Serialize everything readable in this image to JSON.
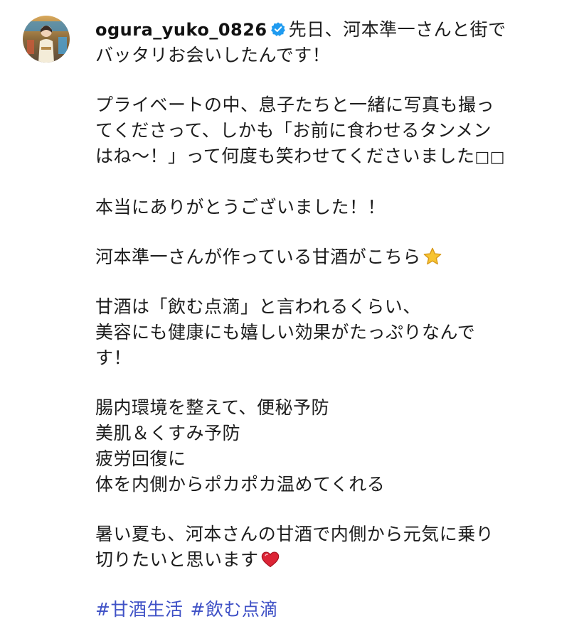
{
  "post": {
    "username": "ogura_yuko_0826",
    "verified_icon": "verified-badge-icon",
    "avatar_icon": "profile-photo",
    "colors": {
      "verified": "#1f9bf0",
      "hashtag": "#3f51c6",
      "text": "#1c1c1c",
      "star": "#f7c431",
      "heart": "#dc2436"
    },
    "caption": {
      "first_line_after_name": "先日、河本準一さんと街で",
      "line2": "バッタリお会いしたんです！",
      "para2_line1": "プライベートの中、息子たちと一緒に写真も撮っ",
      "para2_line2": "てくださって、しかも「お前に食わせるタンメン",
      "para2_line3": "はね〜！」って何度も笑わせてくださいました",
      "para2_line3_tofu": "□□",
      "para3": "本当にありがとうございました！！",
      "para4": "河本準一さんが作っている甘酒がこちら",
      "para4_emoji": "star-emoji",
      "para5_line1": "甘酒は「飲む点滴」と言われるくらい、",
      "para5_line2": "美容にも健康にも嬉しい効果がたっぷりなんで",
      "para5_line3": "す！",
      "list_item1": "腸内環境を整えて、便秘予防",
      "list_item2": "美肌＆くすみ予防",
      "list_item3": "疲労回復に",
      "list_item4": "体を内側からポカポカ温めてくれる",
      "para7_line1": "暑い夏も、河本さんの甘酒で内側から元気に乗り",
      "para7_line2": "切りたいと思います",
      "para7_emoji": "heart-emoji"
    },
    "hashtags": [
      "#甘酒生活",
      "#飲む点滴"
    ]
  }
}
